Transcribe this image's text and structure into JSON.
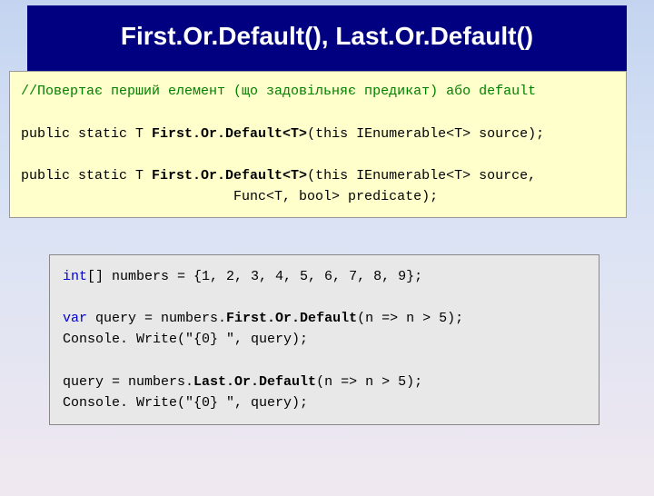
{
  "header": {
    "title": "First.Or.Default(), Last.Or.Default()"
  },
  "sig": {
    "comment": "//Повертає перший елемент (що задовільняє предикат) або default",
    "l1a": "public static T ",
    "l1b": "First.Or.Default<T>",
    "l1c": "(this IEnumerable<T> source);",
    "l2a": "public static T ",
    "l2b": "First.Or.Default<T>",
    "l2c": "(this IEnumerable<T> source,",
    "l3": "                          Func<T, bool> predicate);"
  },
  "code": {
    "kw_int": "int",
    "l1": "[] numbers = {1, 2, 3, 4, 5, 6, 7, 8, 9};",
    "kw_var": "var",
    "l2a": " query = numbers.",
    "l2b": "First.Or.Default",
    "l2c": "(n => n > 5);",
    "l3": "Console. Write(\"{0} \", query);",
    "l4a": "query = numbers.",
    "l4b": "Last.Or.Default",
    "l4c": "(n => n > 5);",
    "l5": "Console. Write(\"{0} \", query);"
  }
}
